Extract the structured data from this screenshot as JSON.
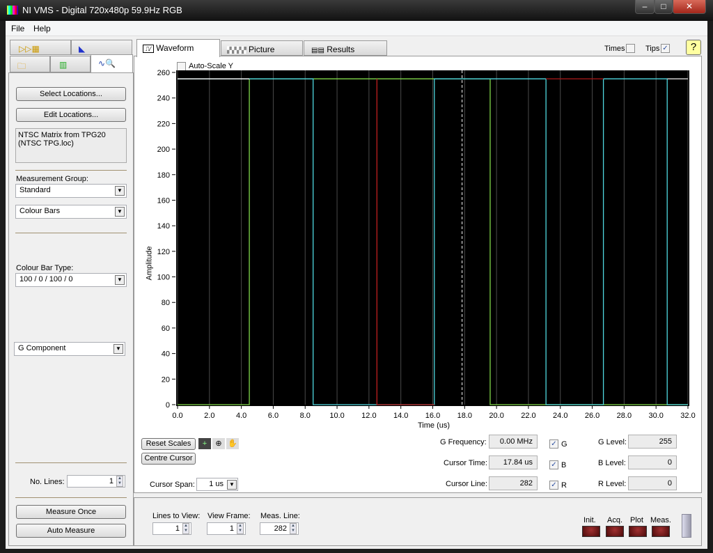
{
  "window": {
    "title": "NI VMS - Digital 720x480p 59.9Hz RGB",
    "minimize": "–",
    "maximize": "□",
    "close": "✕"
  },
  "menu": [
    "File",
    "Help"
  ],
  "left_panel": {
    "select_locations": "Select Locations...",
    "edit_locations": "Edit Locations...",
    "location_info": "NTSC Matrix from TPG20\n(NTSC TPG.loc)",
    "measurement_group_label": "Measurement Group:",
    "measurement_group": "Standard",
    "measurement": "Colour Bars",
    "colour_bar_type_label": "Colour Bar Type:",
    "colour_bar_type": "100 / 0 / 100 / 0",
    "component": "G Component",
    "no_lines_label": "No. Lines:",
    "no_lines": "1",
    "measure_once": "Measure Once",
    "auto_measure": "Auto Measure"
  },
  "tabs": [
    {
      "label": "Waveform",
      "active": true
    },
    {
      "label": "Picture"
    },
    {
      "label": "Results"
    }
  ],
  "options": {
    "times_label": "Times",
    "times": false,
    "tips_label": "Tips",
    "tips": true,
    "help": "?"
  },
  "chart_data": {
    "type": "line",
    "autoscale_label": "Auto-Scale Y",
    "autoscale": false,
    "xlabel": "Time (us)",
    "ylabel": "Amplitude",
    "xlim": [
      0,
      32
    ],
    "ylim": [
      0,
      260
    ],
    "xticks": [
      "0.0",
      "2.0",
      "4.0",
      "6.0",
      "8.0",
      "10.0",
      "12.0",
      "14.0",
      "16.0",
      "18.0",
      "20.0",
      "22.0",
      "24.0",
      "26.0",
      "28.0",
      "30.0",
      "32.0"
    ],
    "yticks": [
      "0",
      "20",
      "40",
      "60",
      "80",
      "100",
      "120",
      "140",
      "160",
      "180",
      "200",
      "220",
      "240",
      "260"
    ],
    "grid": true,
    "cursor_x": 17.84,
    "series": [
      {
        "name": "G",
        "color": "#7fd84a",
        "points": [
          [
            0,
            0
          ],
          [
            4.5,
            0
          ],
          [
            4.5,
            255
          ],
          [
            19.6,
            255
          ],
          [
            19.6,
            0
          ],
          [
            32,
            0
          ]
        ]
      },
      {
        "name": "B",
        "color": "#4fd8e0",
        "points": [
          [
            0,
            255
          ],
          [
            8.5,
            255
          ],
          [
            8.5,
            0
          ],
          [
            16.1,
            0
          ],
          [
            16.1,
            255
          ],
          [
            23.1,
            255
          ],
          [
            23.1,
            0
          ],
          [
            26.7,
            0
          ],
          [
            26.7,
            255
          ],
          [
            30.7,
            255
          ],
          [
            30.7,
            0
          ],
          [
            32,
            0
          ]
        ]
      },
      {
        "name": "R",
        "color": "#c02020",
        "points": [
          [
            12.5,
            255
          ],
          [
            12.5,
            0
          ],
          [
            16.1,
            0
          ],
          [
            16.1,
            0
          ]
        ]
      },
      {
        "name": "R-high",
        "color": "#a01818",
        "points": [
          [
            23.1,
            255
          ],
          [
            26.7,
            255
          ]
        ]
      },
      {
        "name": "white",
        "color": "#ffffff",
        "points": [
          [
            0,
            255
          ],
          [
            4.5,
            255
          ]
        ]
      },
      {
        "name": "white-end",
        "color": "#dddddd",
        "points": [
          [
            30.7,
            255
          ],
          [
            32,
            255
          ]
        ]
      }
    ]
  },
  "controls": {
    "reset_scales": "Reset Scales",
    "centre_cursor": "Centre Cursor",
    "cursor_span_label": "Cursor Span:",
    "cursor_span": "1 us",
    "g_frequency_label": "G Frequency:",
    "g_frequency": "0.00 MHz",
    "cursor_time_label": "Cursor Time:",
    "cursor_time": "17.84 us",
    "cursor_line_label": "Cursor Line:",
    "cursor_line": "282",
    "g_check": "G",
    "b_check": "B",
    "r_check": "R",
    "g_level_label": "G Level:",
    "g_level": "255",
    "b_level_label": "B Level:",
    "b_level": "0",
    "r_level_label": "R Level:",
    "r_level": "0"
  },
  "bottom": {
    "lines_to_view_label": "Lines to View:",
    "lines_to_view": "1",
    "view_frame_label": "View Frame:",
    "view_frame": "1",
    "meas_line_label": "Meas. Line:",
    "meas_line": "282",
    "leds": [
      "Init.",
      "Acq.",
      "Plot",
      "Meas."
    ]
  }
}
